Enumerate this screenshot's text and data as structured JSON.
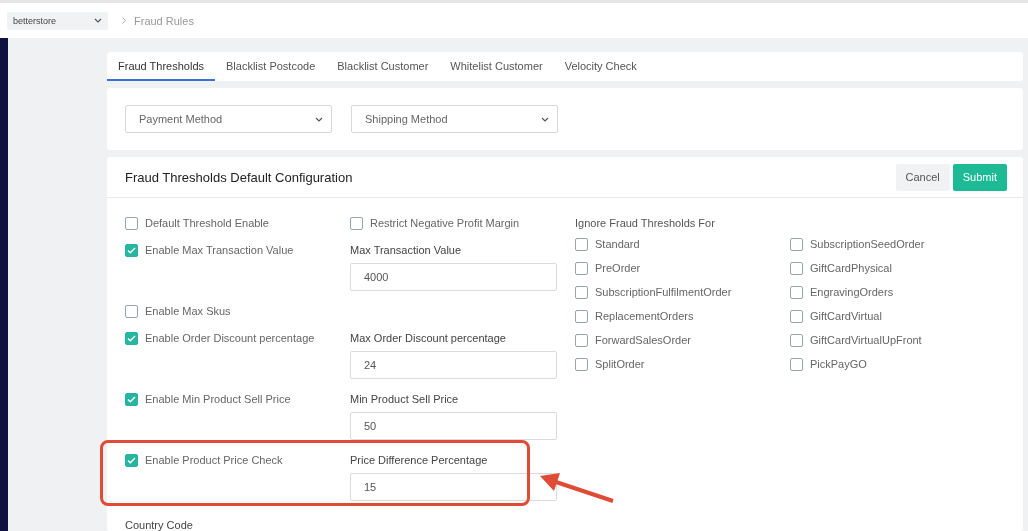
{
  "top_bar": {
    "store_select": {
      "value": "betterstore"
    },
    "breadcrumb": [
      {
        "text": "Fraud Rules"
      }
    ]
  },
  "tabs": [
    {
      "label": "Fraud Thresholds",
      "selected": true
    },
    {
      "label": "Blacklist Postcode",
      "selected": false
    },
    {
      "label": "Blacklist Customer",
      "selected": false
    },
    {
      "label": "Whitelist Customer",
      "selected": false
    },
    {
      "label": "Velocity Check",
      "selected": false
    }
  ],
  "filters": [
    {
      "placeholder": "Payment Method"
    },
    {
      "placeholder": "Shipping Method"
    }
  ],
  "config": {
    "title": "Fraud Thresholds Default Configuration",
    "buttons": [
      {
        "label": "Cancel",
        "kind": "secondary"
      },
      {
        "label": "Submit",
        "kind": "primary"
      }
    ],
    "rows": [
      {
        "label": "Default Threshold Enable",
        "checked": false,
        "side": {
          "label": "Restrict Negative Profit Margin",
          "checked": false
        }
      },
      {
        "label": "Enable Max Transaction Value",
        "checked": true,
        "field": {
          "label": "Max Transaction Value",
          "value": "4000"
        }
      },
      {
        "label": "Enable Max Skus",
        "checked": false
      },
      {
        "label": "Enable Order Discount percentage",
        "checked": true,
        "field": {
          "label": "Max Order Discount percentage",
          "value": "24"
        }
      },
      {
        "label": "Enable Min Product Sell Price",
        "checked": true,
        "field": {
          "label": "Min Product Sell Price",
          "value": "50"
        }
      },
      {
        "label": "Enable Product Price Check",
        "checked": true,
        "highlighted": true,
        "field": {
          "label": "Price Difference Percentage",
          "value": "15"
        }
      }
    ],
    "ignore": {
      "title": "Ignore Fraud Thresholds For",
      "items": [
        {
          "label": "Standard",
          "checked": false
        },
        {
          "label": "SubscriptionSeedOrder",
          "checked": false
        },
        {
          "label": "PreOrder",
          "checked": false
        },
        {
          "label": "GiftCardPhysical",
          "checked": false
        },
        {
          "label": "SubscriptionFulfilmentOrder",
          "checked": false
        },
        {
          "label": "EngravingOrders",
          "checked": false
        },
        {
          "label": "ReplacementOrders",
          "checked": false
        },
        {
          "label": "GiftCardVirtual",
          "checked": false
        },
        {
          "label": "ForwardSalesOrder",
          "checked": false
        },
        {
          "label": "GiftCardVirtualUpFront",
          "checked": false
        },
        {
          "label": "SplitOrder",
          "checked": false
        },
        {
          "label": "PickPayGO",
          "checked": false
        }
      ]
    },
    "next_section_label": "Country Code"
  }
}
